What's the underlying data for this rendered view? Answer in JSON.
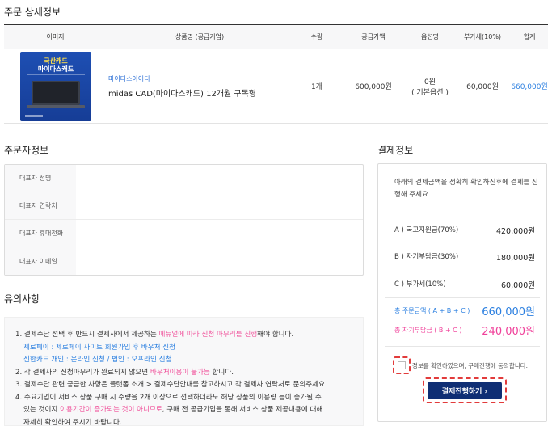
{
  "order_detail": {
    "title": "주문 상세정보",
    "headers": {
      "image": "이미지",
      "product": "상품명 (공급기업)",
      "qty": "수량",
      "supply_price": "공급가액",
      "option": "옵션명",
      "vat": "부가세(10%)",
      "total": "합계"
    },
    "item": {
      "thumb_line1": "국산캐드",
      "thumb_line2": "마이다스캐드",
      "supplier": "마이다스아이티",
      "name": "midas CAD(마이다스캐드) 12개월 구독형",
      "qty": "1개",
      "supply_price": "600,000원",
      "option_price": "0원",
      "option_name": "( 기본옵션 )",
      "vat": "60,000원",
      "total": "660,000원"
    }
  },
  "orderer": {
    "title": "주문자정보",
    "rows": [
      {
        "label": "대표자 성명",
        "value": ""
      },
      {
        "label": "대표자 연락처",
        "value": ""
      },
      {
        "label": "대표자 휴대전화",
        "value": ""
      },
      {
        "label": "대표자 이메일",
        "value": ""
      }
    ]
  },
  "notes": {
    "title": "유의사항",
    "l1_a": "1. 결제수단 선택 후 반드시 결제사에서 제공하는 ",
    "l1_b": "메뉴얼에 따라 신청 마무리를 진행",
    "l1_c": "해야 합니다.",
    "l2": "제로페이 : 제로페이 사이트 회원가입 후 바우처 신청",
    "l3": "신한카드 개인 : 온라인 신청 / 법인 : 오프라인 신청",
    "l4_a": "2. 각 결제사의 신청마무리가 완료되지 않으면 ",
    "l4_b": "바우처이용이 불가능",
    "l4_c": " 합니다.",
    "l5": "3. 결제수단 관련 궁금한 사항은 플랫폼 소개 > 결제수단안내를 참고하시고 각 결제사 연락처로 문의주세요",
    "l6": "4. 수요기업이 서비스 상품 구매 시 수량을 2개 이상으로 선택하더라도 해당 상품의 이용량 등이 증가될 수",
    "l7_a": "있는 것이지 ",
    "l7_b": "이용기간이 증가되는 것이 아니므로",
    "l7_c": ", 구매 전 공급기업을 통해 서비스 상품 제공내용에 대해",
    "l8": "자세히 확인하여 주시기 바랍니다."
  },
  "payment": {
    "title": "결제정보",
    "desc": "아래의 결제금액을 정확히 확인하신후에 결제를 진행해 주세요",
    "lines": [
      {
        "label": "A ) 국고지원금(70%)",
        "amount": "420,000원"
      },
      {
        "label": "B ) 자기부담금(30%)",
        "amount": "180,000원"
      },
      {
        "label": "C ) 부가세(10%)",
        "amount": "60,000원"
      }
    ],
    "total_order_label": "총 주문금액 ( A + B + C )",
    "total_order_amount": "660,000원",
    "total_self_label": "총 자기부담금 ( B + C )",
    "total_self_amount": "240,000원",
    "agree_text": "정보를 확인하였으며, 구매진행에 동의합니다.",
    "button_label": "결제진행하기 ›"
  },
  "colors": {
    "accent_blue": "#2b7fe0",
    "accent_pink": "#f0409a",
    "button_navy": "#0f2e74",
    "highlight_red": "#e23b3b"
  }
}
